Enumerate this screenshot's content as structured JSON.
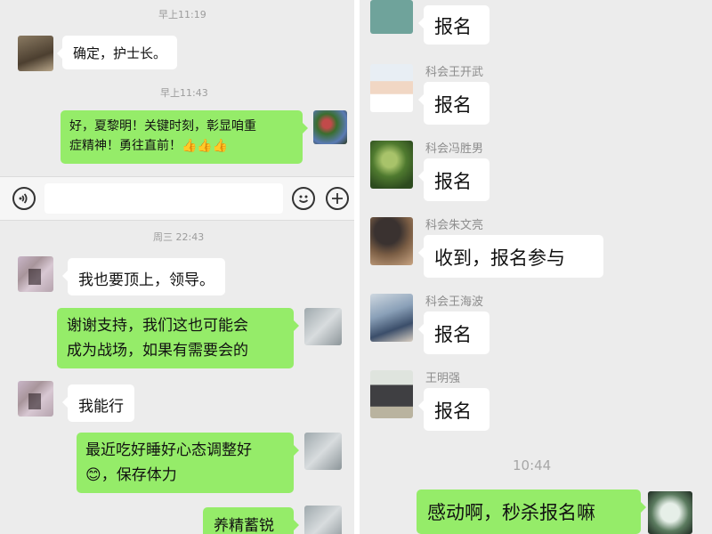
{
  "left_chat": {
    "messages": [
      {
        "time": "早上11:19"
      },
      {
        "sender": "other",
        "text": "确定，护士长。"
      },
      {
        "time": "早上11:43"
      },
      {
        "sender": "self",
        "lines": [
          "好，夏黎明！关键时刻，彰显咱重",
          "症精神！勇往直前！👍👍👍"
        ]
      },
      {
        "time": "周三 22:43"
      },
      {
        "sender": "other",
        "text": "我也要顶上，领导。"
      },
      {
        "sender": "self",
        "lines": [
          "谢谢支持，我们这也可能会",
          "成为战场，如果有需要会的"
        ]
      },
      {
        "sender": "other",
        "text": "我能行"
      },
      {
        "sender": "self",
        "lines": [
          "最近吃好睡好心态调整好",
          "😊，保存体力"
        ]
      },
      {
        "sender": "self",
        "text": "养精蓄锐"
      }
    ],
    "input_bar": {
      "voice_icon": "voice-icon",
      "emoji_icon": "emoji-icon",
      "plus_icon": "plus-icon"
    }
  },
  "right_chat": {
    "messages": [
      {
        "sender_name": "",
        "text": "报名"
      },
      {
        "sender_name": "科会王开武",
        "text": "报名"
      },
      {
        "sender_name": "科会冯胜男",
        "text": "报名"
      },
      {
        "sender_name": "科会朱文亮",
        "text": "收到，报名参与"
      },
      {
        "sender_name": "科会王海波",
        "text": "报名"
      },
      {
        "sender_name": "王明强",
        "text": "报名"
      },
      {
        "time": "10:44"
      },
      {
        "sender": "self",
        "text": "感动啊，秒杀报名嘛"
      }
    ]
  },
  "colors": {
    "background": "#ececec",
    "self_bubble": "#95ec69",
    "other_bubble": "#ffffff"
  }
}
